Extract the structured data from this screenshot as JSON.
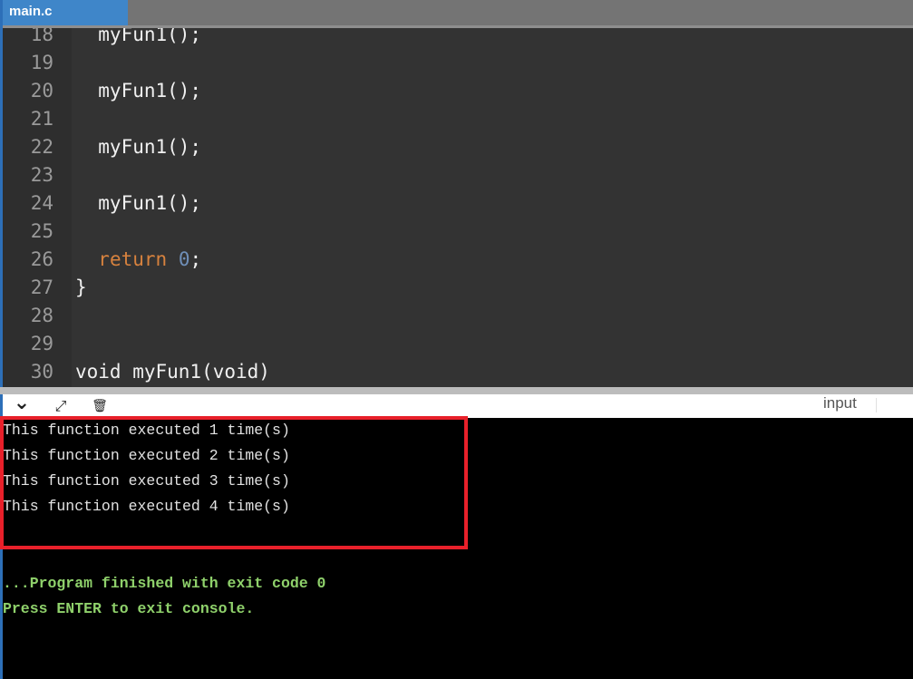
{
  "tab": {
    "label": "main.c"
  },
  "editor": {
    "lines": [
      {
        "number": "18",
        "code": "  myFun1();"
      },
      {
        "number": "19",
        "code": ""
      },
      {
        "number": "20",
        "code": "  myFun1();"
      },
      {
        "number": "21",
        "code": ""
      },
      {
        "number": "22",
        "code": "  myFun1();"
      },
      {
        "number": "23",
        "code": ""
      },
      {
        "number": "24",
        "code": "  myFun1();"
      },
      {
        "number": "25",
        "code": ""
      },
      {
        "number": "26",
        "keyword": "return",
        "value": "0",
        "terminator": ";"
      },
      {
        "number": "27",
        "code": "}"
      },
      {
        "number": "28",
        "code": ""
      },
      {
        "number": "29",
        "code": ""
      },
      {
        "number": "30",
        "code": "void myFun1(void)"
      }
    ]
  },
  "toolbar": {
    "collapse_icon": "chevron-down-icon",
    "expand_icon": "expand-arrows-icon",
    "clear_icon": "clear-console-icon",
    "collapse_glyph": "⌄",
    "expand_glyph": "⤢",
    "clear_glyph": "🗑",
    "input_label": "input"
  },
  "console": {
    "output_lines": [
      "This function executed 1 time(s)",
      "This function executed 2 time(s)",
      "This function executed 3 time(s)",
      "This function executed 4 time(s)"
    ],
    "status_lines": [
      "...Program finished with exit code 0",
      "Press ENTER to exit console."
    ]
  },
  "colors": {
    "tab_active": "#3f86c9",
    "highlight_box": "#e8202a",
    "console_status": "#8fd16b",
    "keyword_return": "#d7823e"
  }
}
